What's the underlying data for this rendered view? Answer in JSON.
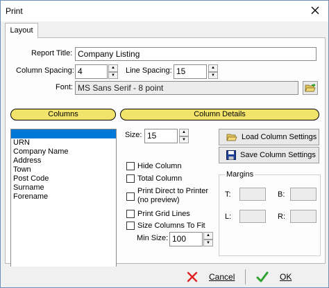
{
  "window": {
    "title": "Print"
  },
  "tabs": [
    {
      "label": "Layout"
    }
  ],
  "form": {
    "report_title_label": "Report Title:",
    "report_title_value": "Company Listing",
    "column_spacing_label": "Column Spacing:",
    "column_spacing_value": "4",
    "line_spacing_label": "Line Spacing:",
    "line_spacing_value": "15",
    "font_label": "Font:",
    "font_value": "MS Sans Serif - 8 point"
  },
  "sections": {
    "columns_header": "Columns",
    "details_header": "Column Details"
  },
  "columns_list": {
    "selected_index": 0,
    "items": [
      "",
      "URN",
      "Company Name",
      "Address",
      "Town",
      "Post Code",
      "Surname",
      "Forename"
    ]
  },
  "details": {
    "size_label": "Size:",
    "size_value": "15",
    "load_button": "Load Column Settings",
    "save_button": "Save Column Settings",
    "hide_column": "Hide Column",
    "total_column": "Total Column",
    "print_direct_line1": "Print Direct to Printer",
    "print_direct_line2": "(no preview)",
    "print_grid_lines": "Print Grid Lines",
    "size_columns_to_fit": "Size Columns To Fit",
    "min_size_label": "Min Size:",
    "min_size_value": "100"
  },
  "margins": {
    "title": "Margins",
    "top_label": "T:",
    "bottom_label": "B:",
    "left_label": "L:",
    "right_label": "R:",
    "top_value": "",
    "bottom_value": "",
    "left_value": "",
    "right_value": ""
  },
  "footer": {
    "cancel_label": "Cancel",
    "ok_label": "OK"
  },
  "colors": {
    "section_header": "#f2e46a",
    "selection": "#0078d7",
    "cancel_icon": "#e02020",
    "ok_icon": "#2fa12f"
  },
  "icons": [
    "close-icon",
    "folder-open-icon",
    "folder-open-icon",
    "floppy-disk-icon",
    "cancel-x-icon",
    "ok-check-icon"
  ]
}
